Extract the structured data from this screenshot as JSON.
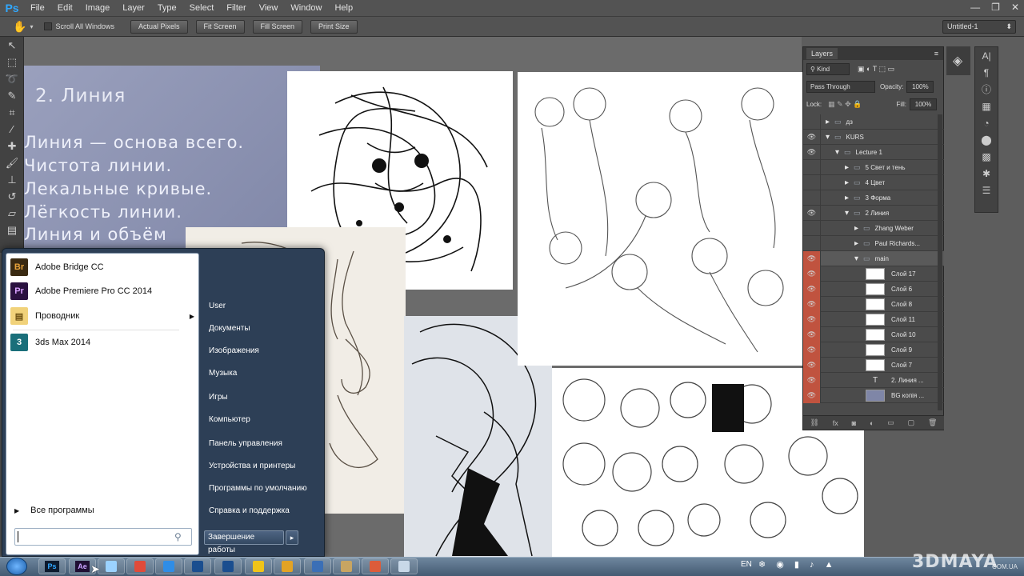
{
  "app": {
    "logo": "Ps",
    "window_controls": [
      "—",
      "❐",
      "✕"
    ]
  },
  "menubar": {
    "items": [
      "File",
      "Edit",
      "Image",
      "Layer",
      "Type",
      "Select",
      "Filter",
      "View",
      "Window",
      "Help"
    ]
  },
  "options": {
    "scroll_all_windows": "Scroll All Windows",
    "buttons": [
      "Actual Pixels",
      "Fit Screen",
      "Fill Screen",
      "Print Size"
    ],
    "document": "Untitled-1"
  },
  "slide": {
    "title": "2. Линия",
    "lines": [
      "Линия — основа всего.",
      "Чистота линии.",
      "Лекальные кривые.",
      "Лёгкость линии.",
      "Линия и объём"
    ]
  },
  "layers": {
    "title": "Layers",
    "filter_kind": "Kind",
    "blend_mode": "Pass Through",
    "opacity_label": "Opacity:",
    "opacity_value": "100%",
    "lock_label": "Lock:",
    "fill_label": "Fill:",
    "fill_value": "100%",
    "rows": [
      {
        "name": "дз",
        "type": "folder",
        "indent": 0,
        "expanded": false,
        "visible": false,
        "red": false
      },
      {
        "name": "KURS",
        "type": "folder",
        "indent": 0,
        "expanded": true,
        "visible": true,
        "red": false
      },
      {
        "name": "Lecture 1",
        "type": "folder",
        "indent": 1,
        "expanded": true,
        "visible": true,
        "red": false
      },
      {
        "name": "5 Свет и тень",
        "type": "folder",
        "indent": 2,
        "expanded": false,
        "visible": false,
        "red": false
      },
      {
        "name": "4 Цвет",
        "type": "folder",
        "indent": 2,
        "expanded": false,
        "visible": false,
        "red": false
      },
      {
        "name": "3 Форма",
        "type": "folder",
        "indent": 2,
        "expanded": false,
        "visible": false,
        "red": false
      },
      {
        "name": "2 Линия",
        "type": "folder",
        "indent": 2,
        "expanded": true,
        "visible": true,
        "red": false
      },
      {
        "name": "Zhang Weber",
        "type": "folder",
        "indent": 3,
        "expanded": false,
        "visible": false,
        "red": false
      },
      {
        "name": "Paul Richards...",
        "type": "folder",
        "indent": 3,
        "expanded": false,
        "visible": false,
        "red": false
      },
      {
        "name": "main",
        "type": "folder",
        "indent": 3,
        "expanded": true,
        "visible": true,
        "red": true
      },
      {
        "name": "Слой 17",
        "type": "layer",
        "visible": true,
        "red": true
      },
      {
        "name": "Слой 6",
        "type": "layer",
        "visible": true,
        "red": true
      },
      {
        "name": "Слой 8",
        "type": "layer",
        "visible": true,
        "red": true
      },
      {
        "name": "Слой 11",
        "type": "layer",
        "visible": true,
        "red": true
      },
      {
        "name": "Слой 10",
        "type": "layer",
        "visible": true,
        "red": true
      },
      {
        "name": "Слой 9",
        "type": "layer",
        "visible": true,
        "red": true
      },
      {
        "name": "Слой 7",
        "type": "layer",
        "visible": true,
        "red": true
      },
      {
        "name": "2. Линия ...",
        "type": "text",
        "visible": true,
        "red": true
      },
      {
        "name": "BG копія ...",
        "type": "layer",
        "visible": true,
        "red": true
      }
    ]
  },
  "startmenu": {
    "pinned": [
      {
        "label": "Adobe Bridge CC",
        "icon": "Br",
        "color": "#3a2a12",
        "fg": "#e8a33a"
      },
      {
        "label": "Adobe Premiere Pro CC 2014",
        "icon": "Pr",
        "color": "#2a1140",
        "fg": "#d8a0ff"
      },
      {
        "label": "Проводник",
        "icon": "📁",
        "color": "#f1d27a",
        "fg": "#6a4e10"
      },
      {
        "label": "3ds Max 2014",
        "icon": "3",
        "color": "#1a6f7a",
        "fg": "#ffffff"
      }
    ],
    "all_programs": "Все программы",
    "search_placeholder": "",
    "right_items": [
      "User",
      "Документы",
      "Изображения",
      "Музыка",
      "Игры",
      "Компьютер",
      "Панель управления",
      "Устройства и принтеры",
      "Программы по умолчанию",
      "Справка и поддержка"
    ],
    "shutdown": "Завершение работы"
  },
  "taskbar": {
    "apps": [
      "Ps",
      "Ae",
      "",
      "",
      "",
      "",
      "",
      "",
      "",
      "",
      "",
      "",
      "",
      ""
    ],
    "language": "EN"
  },
  "watermark": {
    "brand": "3DMAYA",
    "sub": "COM.UA"
  }
}
